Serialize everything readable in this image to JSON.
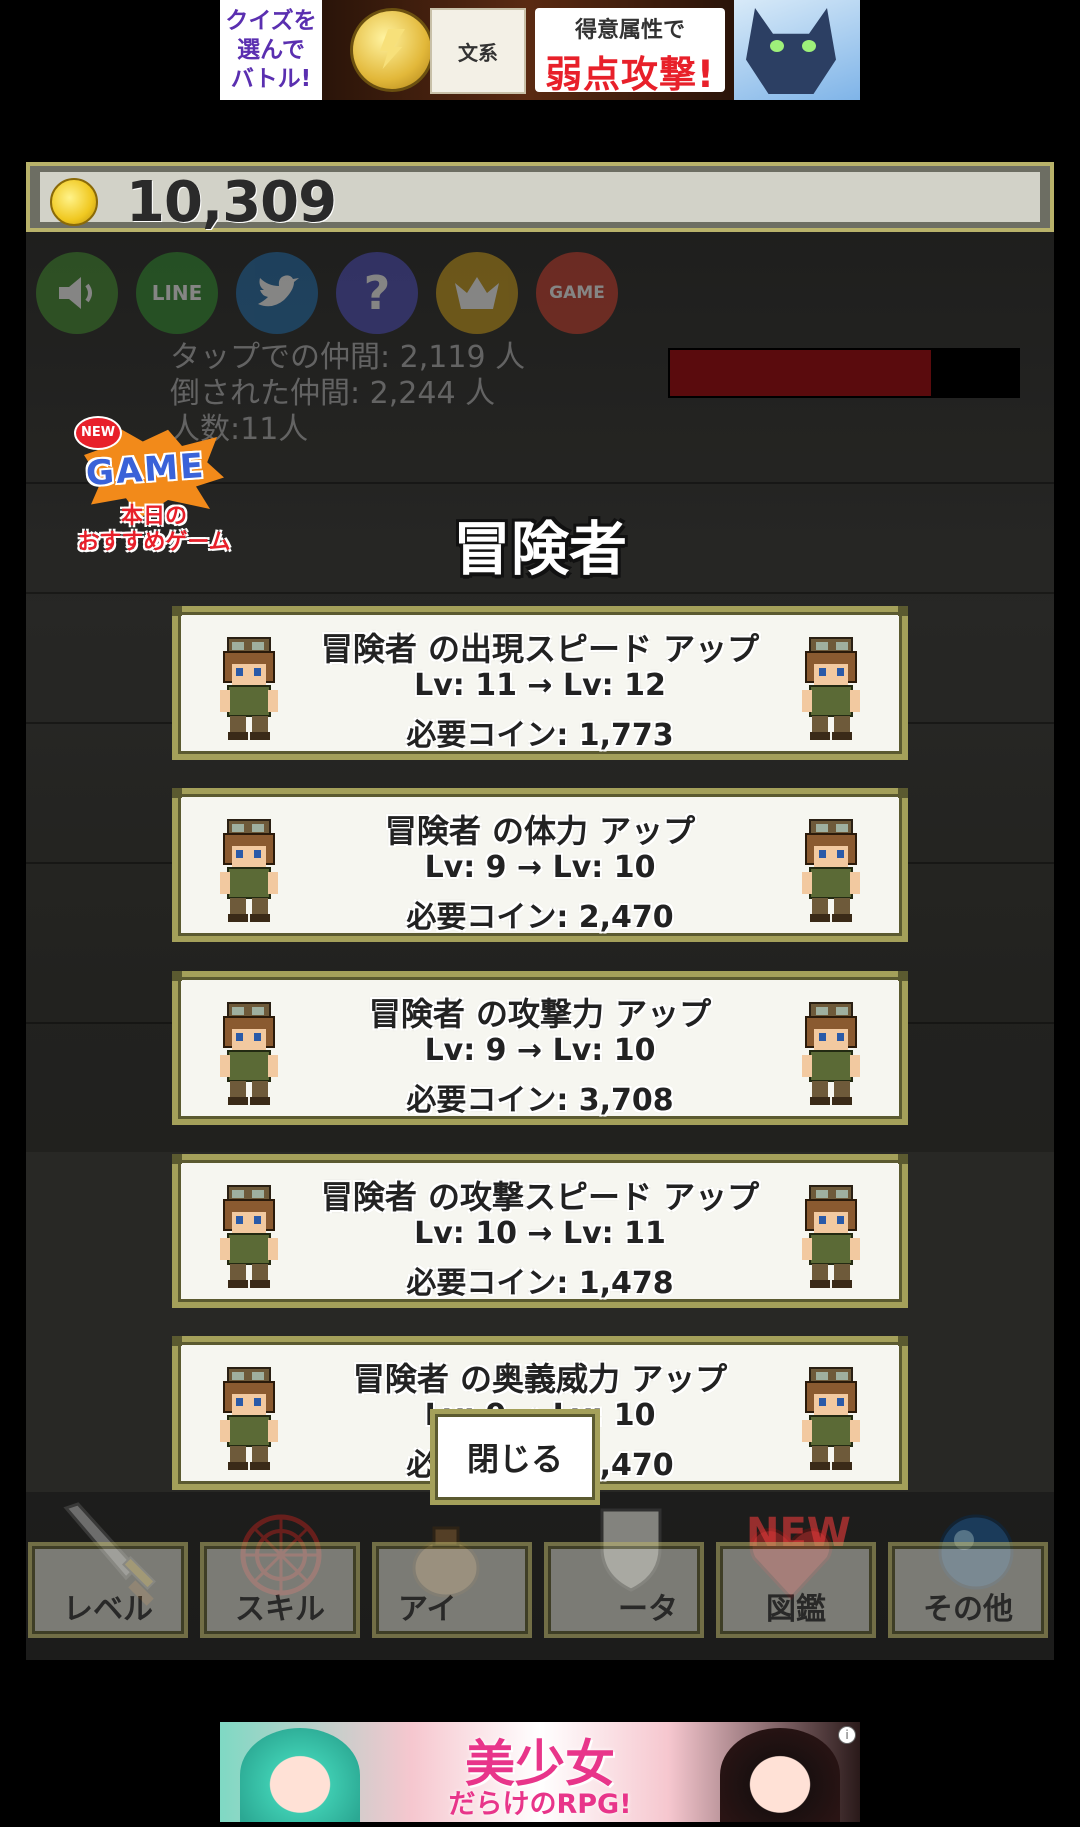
{
  "ads": {
    "top": {
      "left_text": "クイズを\n選んで\nバトル!",
      "tag": "文系",
      "line1": "得意属性で",
      "line2": "弱点攻撃!"
    },
    "bottom": {
      "line1": "美少女",
      "line2": "だらけのRPG!",
      "info": "i"
    }
  },
  "hud": {
    "coins": "10,309",
    "hp_fraction": 0.75,
    "buttons": [
      {
        "name": "sound",
        "label": "",
        "color": "#3f8a2c"
      },
      {
        "name": "line",
        "label": "LINE",
        "color": "#2e8a2c"
      },
      {
        "name": "twitter",
        "label": "",
        "color": "#1e6aa8"
      },
      {
        "name": "help",
        "label": "?",
        "color": "#4a4ab8"
      },
      {
        "name": "ranking",
        "label": "",
        "color": "#c89a16"
      },
      {
        "name": "game",
        "label": "GAME",
        "color": "#c83a2a"
      }
    ],
    "stats": [
      "タップでの仲間: 2,119 人",
      "倒された仲間: 2,244 人",
      "人数:11人"
    ]
  },
  "promo": {
    "new": "NEW",
    "game": "GAME",
    "caption_1": "本日の",
    "caption_2": "おすすめゲーム"
  },
  "panel": {
    "title": "冒険者",
    "upgrades": [
      {
        "title": "冒険者 の出現スピード アップ",
        "levels": "Lv: 11 → Lv: 12",
        "cost": "必要コイン: 1,773"
      },
      {
        "title": "冒険者 の体力 アップ",
        "levels": "Lv: 9 → Lv: 10",
        "cost": "必要コイン: 2,470"
      },
      {
        "title": "冒険者 の攻撃力 アップ",
        "levels": "Lv: 9 → Lv: 10",
        "cost": "必要コイン: 3,708"
      },
      {
        "title": "冒険者 の攻撃スピード アップ",
        "levels": "Lv: 10 → Lv: 11",
        "cost": "必要コイン: 1,478"
      },
      {
        "title": "冒険者 の奥義威力 アップ",
        "levels": "Lv: 9 → Lv: 10",
        "cost": "必要コイン: 2,470"
      }
    ],
    "close_label": "閉じる"
  },
  "nav": {
    "items": [
      "レベル",
      "スキル",
      "アイ",
      "ータ",
      "図鑑",
      "その他"
    ],
    "new_badge": "NEW"
  }
}
